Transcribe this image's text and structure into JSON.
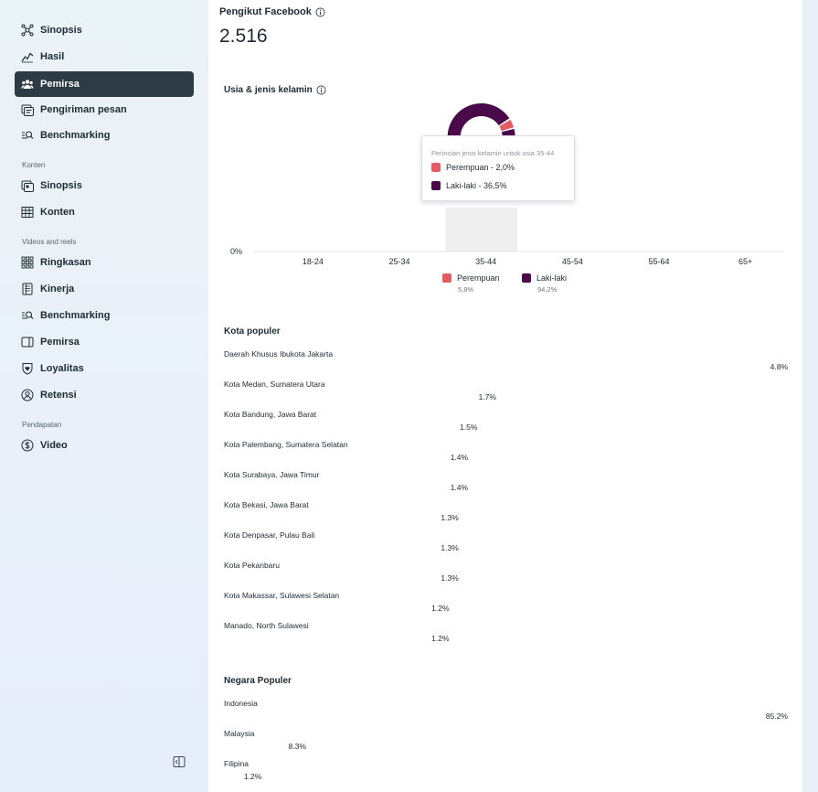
{
  "sidebar": {
    "items": [
      {
        "label": "Sinopsis",
        "icon": "network-icon"
      },
      {
        "label": "Hasil",
        "icon": "trend-icon"
      },
      {
        "label": "Pemirsa",
        "icon": "people-icon",
        "active": true
      },
      {
        "label": "Pengiriman pesan",
        "icon": "messages-icon"
      },
      {
        "label": "Benchmarking",
        "icon": "benchmark-icon"
      }
    ],
    "sections": [
      {
        "label": "Konten",
        "items": [
          {
            "label": "Sinopsis",
            "icon": "posts-icon"
          },
          {
            "label": "Konten",
            "icon": "table-icon"
          }
        ]
      },
      {
        "label": "Videos and reels",
        "items": [
          {
            "label": "Ringkasan",
            "icon": "grid-icon"
          },
          {
            "label": "Kinerja",
            "icon": "document-icon"
          },
          {
            "label": "Benchmarking",
            "icon": "benchmark-icon"
          },
          {
            "label": "Pemirsa",
            "icon": "video-icon"
          },
          {
            "label": "Loyalitas",
            "icon": "heart-shield-icon"
          },
          {
            "label": "Retensi",
            "icon": "person-circle-icon"
          }
        ]
      },
      {
        "label": "Pendapatan",
        "items": [
          {
            "label": "Video",
            "icon": "dollar-icon"
          }
        ]
      }
    ]
  },
  "followers": {
    "title": "Pengikut Facebook",
    "count": "2.516"
  },
  "age_gender": {
    "title": "Usia & jenis kelamin",
    "tooltip": {
      "title": "Perincian jenis kelamin untuk usia 35-44",
      "rows": [
        {
          "label": "Perempuan - 2,0%",
          "color": "#e25c64"
        },
        {
          "label": "Laki-laki - 36,5%",
          "color": "#4a0a4a"
        }
      ]
    },
    "legend": [
      {
        "label": "Perempuan",
        "value": "5,8%",
        "color": "#e25c64"
      },
      {
        "label": "Laki-laki",
        "value": "94,2%",
        "color": "#4a0a4a"
      }
    ]
  },
  "chart_data": {
    "type": "bar",
    "categories": [
      "18-24",
      "25-34",
      "35-44",
      "45-54",
      "55-64",
      "65+"
    ],
    "series": [
      {
        "name": "Perempuan",
        "values": [
          null,
          null,
          2.0,
          null,
          null,
          null
        ]
      },
      {
        "name": "Laki-laki",
        "values": [
          null,
          null,
          36.5,
          null,
          null,
          null
        ]
      }
    ],
    "y_tick_labels": [
      "0%"
    ],
    "highlighted_category": "35-44",
    "colors": {
      "Perempuan": "#e25c64",
      "Laki-laki": "#4a0a4a"
    }
  },
  "cities": {
    "title": "Kota populer",
    "rows": [
      {
        "label": "Daerah Khusus Ibukota Jakarta",
        "value": "4.8%"
      },
      {
        "label": "Kota Medan, Sumatera Utara",
        "value": "1.7%"
      },
      {
        "label": "Kota Bandung, Jawa Barat",
        "value": "1.5%"
      },
      {
        "label": "Kota Palembang, Sumatera Selatan",
        "value": "1.4%"
      },
      {
        "label": "Kota Surabaya, Jawa Timur",
        "value": "1.4%"
      },
      {
        "label": "Kota Bekasi, Jawa Barat",
        "value": "1.3%"
      },
      {
        "label": "Kota Denpasar, Pulau Bali",
        "value": "1.3%"
      },
      {
        "label": "Kota Pekanbaru",
        "value": "1.3%"
      },
      {
        "label": "Kota Makassar, Sulawesi Selatan",
        "value": "1.2%"
      },
      {
        "label": "Manado, North Sulawesi",
        "value": "1.2%"
      }
    ]
  },
  "countries": {
    "title": "Negara Populer",
    "rows": [
      {
        "label": "Indonesia",
        "value": "85.2%"
      },
      {
        "label": "Malaysia",
        "value": "8.3%"
      },
      {
        "label": "Filipina",
        "value": "1.2%"
      }
    ]
  }
}
